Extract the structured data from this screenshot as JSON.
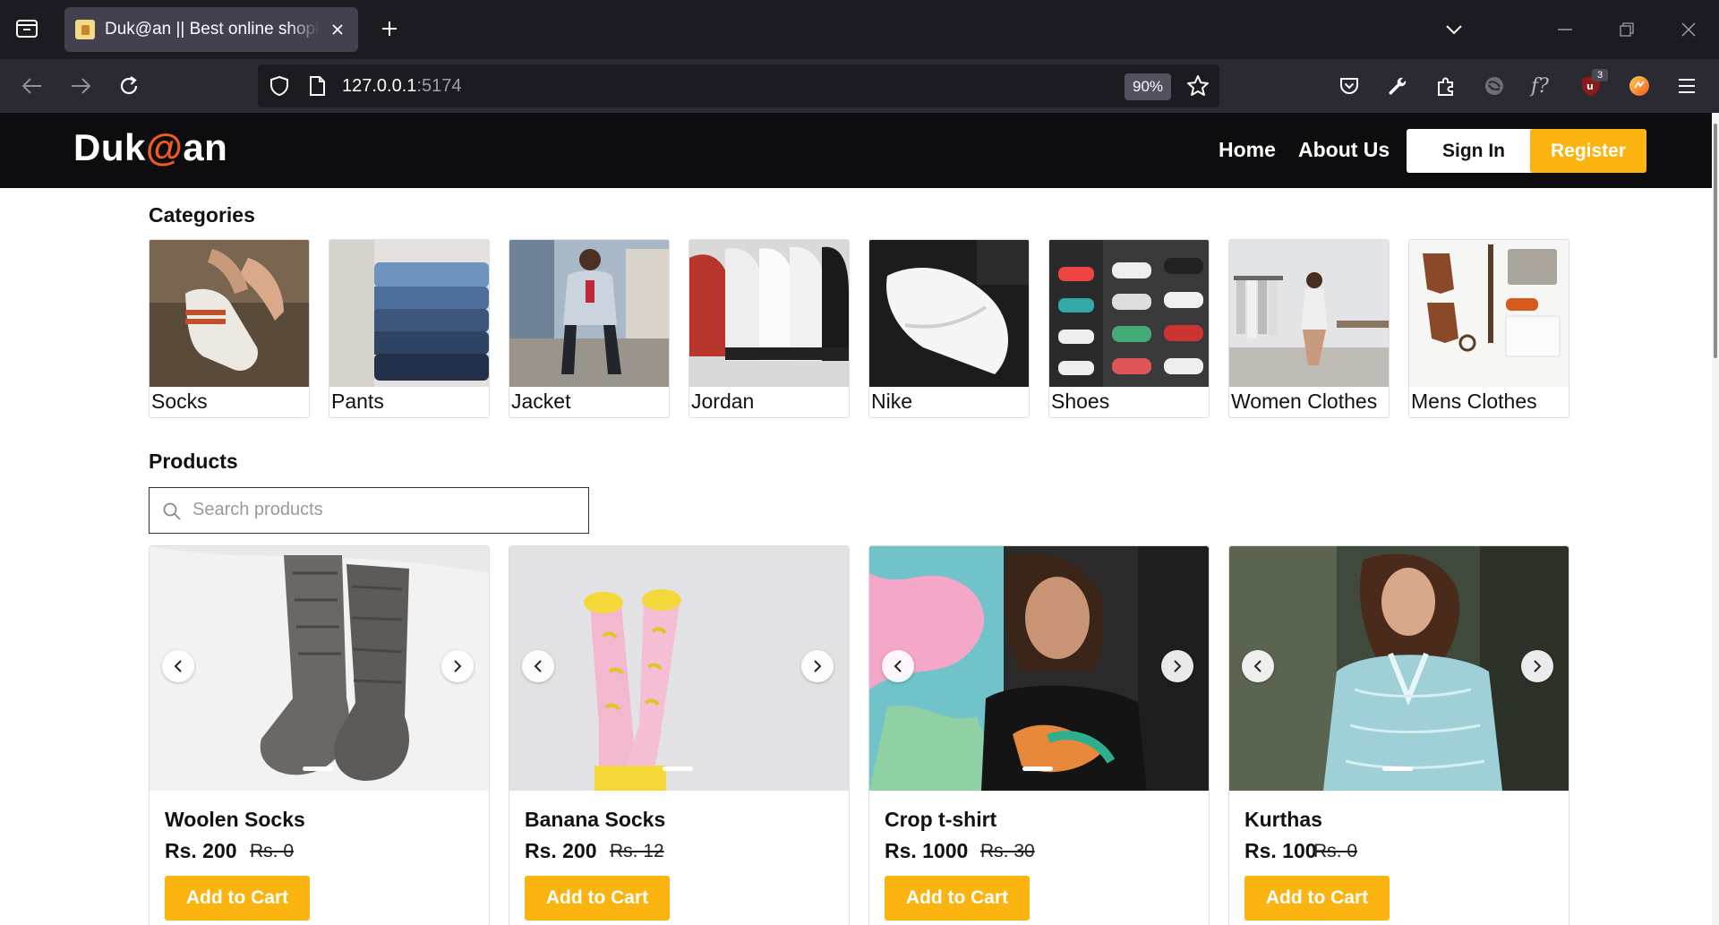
{
  "browser": {
    "tab_title": "Duk@an || Best online shoping",
    "url_host": "127.0.0.1",
    "url_port": ":5174",
    "zoom": "90%",
    "extension_badge": "3"
  },
  "site": {
    "logo_prefix": "Duk",
    "logo_at": "@",
    "logo_suffix": "an",
    "nav": {
      "home": "Home",
      "about": "About Us"
    },
    "signin_label": "Sign In",
    "register_label": "Register",
    "accent_color": "#fbb40f"
  },
  "categories": {
    "title": "Categories",
    "items": [
      {
        "label": "Socks"
      },
      {
        "label": "Pants"
      },
      {
        "label": "Jacket"
      },
      {
        "label": "Jordan"
      },
      {
        "label": "Nike"
      },
      {
        "label": "Shoes"
      },
      {
        "label": "Women Clothes"
      },
      {
        "label": "Mens Clothes"
      }
    ]
  },
  "products": {
    "title": "Products",
    "search_placeholder": "Search products",
    "add_to_cart_label": "Add to Cart",
    "items": [
      {
        "name": "Woolen Socks",
        "price": "Rs. 200",
        "old_price": "Rs. 0"
      },
      {
        "name": "Banana Socks",
        "price": "Rs. 200",
        "old_price": "Rs. 12"
      },
      {
        "name": "Crop t-shirt",
        "price": "Rs. 1000",
        "old_price": "Rs. 30"
      },
      {
        "name": "Kurthas",
        "price": "Rs. 100",
        "old_price": "Rs. 0"
      }
    ]
  }
}
